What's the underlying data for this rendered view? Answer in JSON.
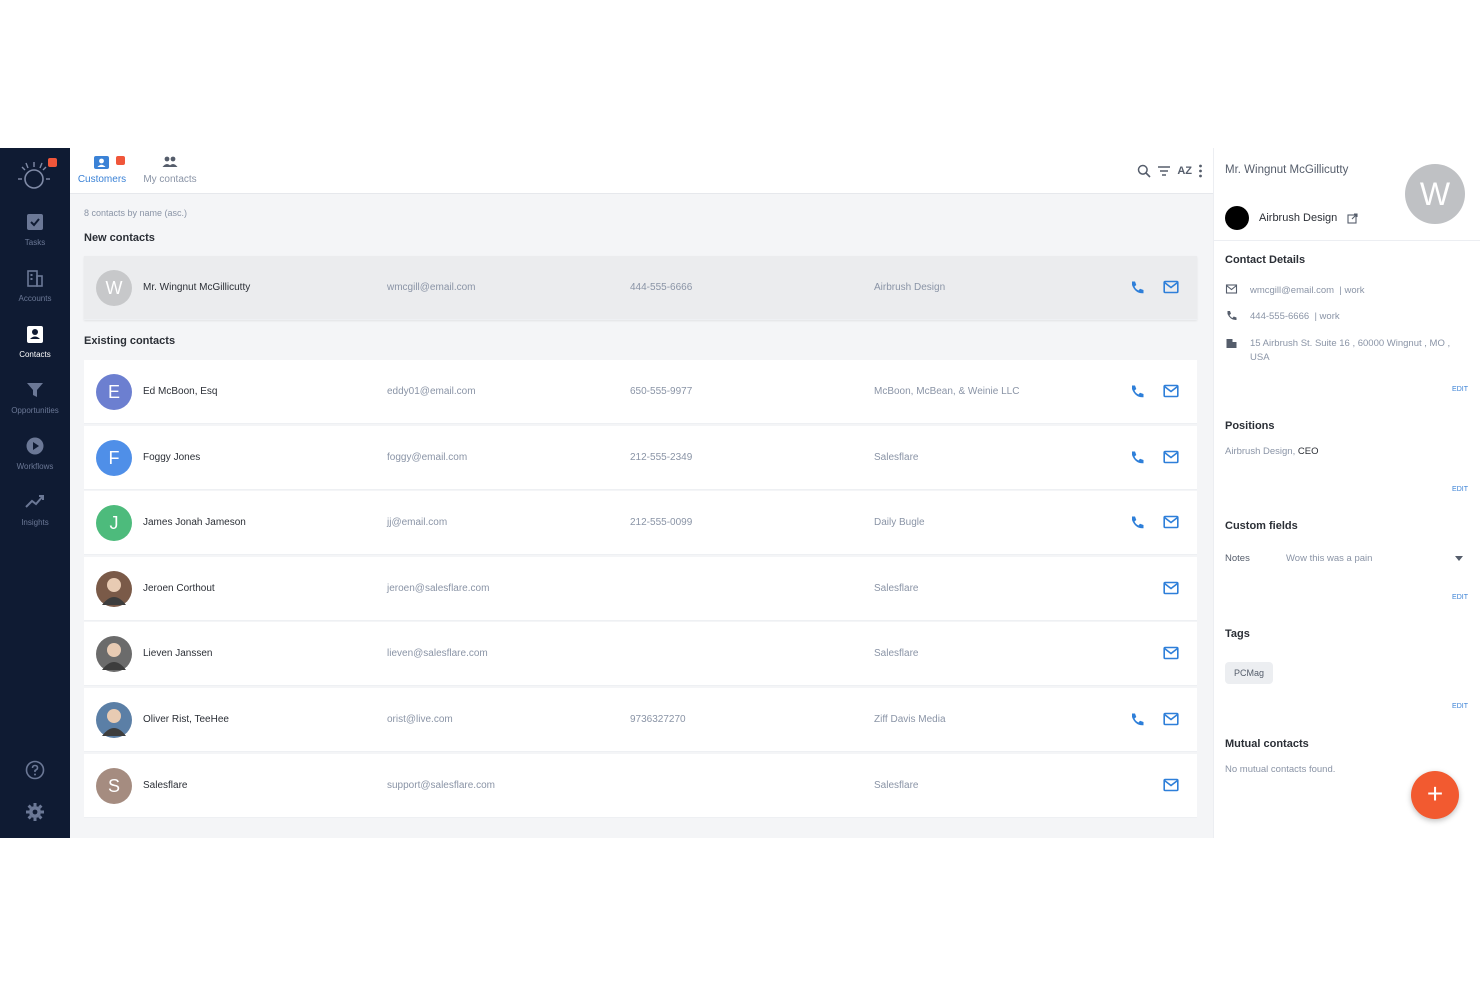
{
  "nav": {
    "items": [
      {
        "label": "Tasks"
      },
      {
        "label": "Accounts"
      },
      {
        "label": "Contacts"
      },
      {
        "label": "Opportunities"
      },
      {
        "label": "Workflows"
      },
      {
        "label": "Insights"
      }
    ],
    "active": "Contacts"
  },
  "tabs": [
    {
      "label": "Customers",
      "badge": "1"
    },
    {
      "label": "My contacts"
    }
  ],
  "toolbar": {
    "sort_label": "AZ"
  },
  "list": {
    "meta": "8 contacts by name (asc.)",
    "new_heading": "New contacts",
    "existing_heading": "Existing contacts",
    "new_contacts": [
      {
        "initial": "W",
        "name": "Mr. Wingnut McGillicutty",
        "email": "wmcgill@email.com",
        "phone": "444-555-6666",
        "company": "Airbrush Design",
        "color": "#c7c8ca",
        "has_phone": true
      }
    ],
    "existing_contacts": [
      {
        "initial": "E",
        "name": "Ed McBoon, Esq",
        "email": "eddy01@email.com",
        "phone": "650-555-9977",
        "company": "McBoon, McBean, & Weinie LLC",
        "color": "#6c7fd0",
        "has_phone": true
      },
      {
        "initial": "F",
        "name": "Foggy Jones",
        "email": "foggy@email.com",
        "phone": "212-555-2349",
        "company": "Salesflare",
        "color": "#4f8fe8",
        "has_phone": true
      },
      {
        "initial": "J",
        "name": "James Jonah Jameson",
        "email": "jj@email.com",
        "phone": "212-555-0099",
        "company": "Daily Bugle",
        "color": "#4dbb7c",
        "has_phone": true
      },
      {
        "initial": "",
        "name": "Jeroen Corthout",
        "email": "jeroen@salesflare.com",
        "phone": "",
        "company": "Salesflare",
        "color": "#7a5a48",
        "has_phone": false
      },
      {
        "initial": "",
        "name": "Lieven Janssen",
        "email": "lieven@salesflare.com",
        "phone": "",
        "company": "Salesflare",
        "color": "#6b6b6b",
        "has_phone": false
      },
      {
        "initial": "",
        "name": "Oliver Rist, TeeHee",
        "email": "orist@live.com",
        "phone": "9736327270",
        "company": "Ziff Davis Media",
        "color": "#5b7fa6",
        "has_phone": true
      },
      {
        "initial": "S",
        "name": "Salesflare",
        "email": "support@salesflare.com",
        "phone": "",
        "company": "Salesflare",
        "color": "#a58c80",
        "has_phone": false
      }
    ]
  },
  "detail": {
    "name": "Mr. Wingnut McGillicutty",
    "avatar_initial": "W",
    "company": "Airbrush Design",
    "contact_details_heading": "Contact Details",
    "email": "wmcgill@email.com",
    "email_type": "| work",
    "phone": "444-555-6666",
    "phone_type": "| work",
    "address": "15 Airbrush St. Suite 16 ,  60000 Wingnut , MO ,  USA",
    "edit_label": "EDIT",
    "positions_heading": "Positions",
    "position_company": "Airbrush Design,",
    "position_title": "CEO",
    "custom_fields_heading": "Custom fields",
    "notes_label": "Notes",
    "notes_value": "Wow this was a pain",
    "tags_heading": "Tags",
    "tag": "PCMag",
    "mutual_heading": "Mutual contacts",
    "mutual_empty": "No mutual contacts found.",
    "fab_label": "+"
  },
  "colors": {
    "sidebar": "#0f1b33",
    "accent": "#3b82d6",
    "fab": "#f25a30",
    "badge": "#f0563a"
  }
}
